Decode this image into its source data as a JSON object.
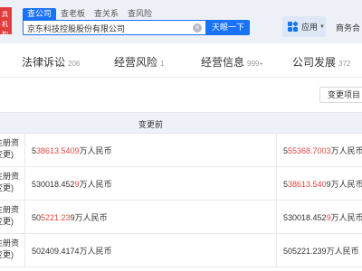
{
  "header": {
    "logo_lines": [
      "具",
      "机构"
    ],
    "search_tabs": [
      "查公司",
      "查老板",
      "查关系",
      "查风险"
    ],
    "search_value": "京东科技控股股份有限公司",
    "search_button": "天眼一下",
    "apps_label": "应用",
    "business_link": "商务合"
  },
  "nav": {
    "tabs": [
      {
        "label": "法律诉讼",
        "count": "206"
      },
      {
        "label": "经营风险",
        "count": "1"
      },
      {
        "label": "经营信息",
        "count": "999+"
      },
      {
        "label": "公司发展",
        "count": "372"
      }
    ]
  },
  "toolbar": {
    "change_item_select": "变更项目"
  },
  "table": {
    "header_before": "变更前",
    "rows": [
      {
        "item_lines": [
          "注册资",
          "变更)"
        ],
        "before": {
          "pre": "5",
          "hl": "38613.5409",
          "post": "万人民币"
        },
        "after": {
          "pre": "5",
          "hl": "55368.7003",
          "post": "万人民币"
        }
      },
      {
        "item_lines": [
          "注册资",
          "变更)"
        ],
        "before": {
          "pre": "530018.452",
          "hl": "9",
          "post": "万人民币"
        },
        "after": {
          "pre": "5",
          "hl": "38613.540",
          "post": "9万人民币"
        }
      },
      {
        "item_lines": [
          "注册资",
          "变更)"
        ],
        "before": {
          "pre": "50",
          "hl": "5221.23",
          "post": "9万人民币"
        },
        "after": {
          "pre": "530018.452",
          "hl": "9",
          "post": "万人民币"
        }
      },
      {
        "item_lines": [
          "注册资",
          "变更)"
        ],
        "before": {
          "pre": "502409.4174",
          "hl": "",
          "post": "万人民币"
        },
        "after": {
          "pre": "505221.239",
          "hl": "",
          "post": "万人民币"
        }
      }
    ]
  },
  "colors": {
    "brand_blue": "#1a72f7",
    "highlight_red": "#e2463d",
    "header_bg": "#edf1f7",
    "table_head_bg": "#eef2f8"
  },
  "icons": [
    "search-clear-icon",
    "apps-grid-icon",
    "chevron-down-icon"
  ]
}
